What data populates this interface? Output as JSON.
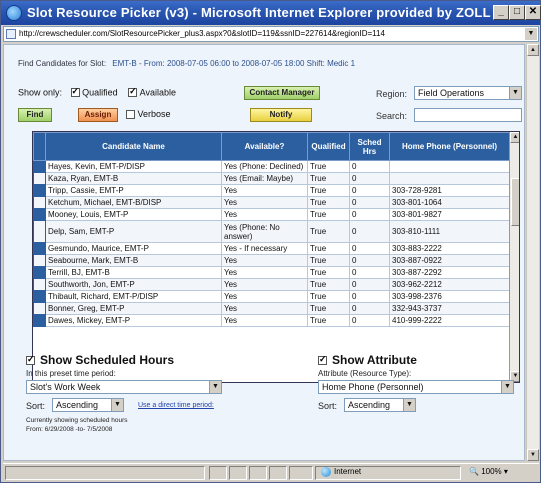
{
  "window": {
    "title": "Slot Resource Picker (v3) - Microsoft Internet Explorer provided by ZOLL",
    "min": "_",
    "max": "□",
    "close": "✕"
  },
  "address": {
    "url": "http://crewscheduler.com/SlotResourcePicker_plus3.aspx?0&slotID=119&ssnID=227614&regionID=114"
  },
  "header": {
    "find_label": "Find Candidates for Slot:",
    "slot_info": "EMT-B - From: 2008-07-05 06:00 to 2008-07-05 18:00 Shift: Medic 1"
  },
  "filters": {
    "show_only": "Show only:",
    "qualified": "Qualified",
    "available": "Available",
    "verbose": "Verbose",
    "qualified_checked": true,
    "available_checked": true,
    "verbose_checked": false
  },
  "buttons": {
    "find": "Find",
    "assign": "Assign",
    "contact_manager": "Contact Manager",
    "notify": "Notify"
  },
  "region": {
    "label": "Region:",
    "value": "Field Operations"
  },
  "search": {
    "label": "Search:",
    "value": ""
  },
  "grid": {
    "columns": [
      "Candidate Name",
      "Available?",
      "Qualified",
      "Sched Hrs",
      "Home Phone (Personnel)"
    ],
    "rows": [
      [
        "Hayes, Kevin, EMT-P/DISP",
        "Yes (Phone: Declined)",
        "True",
        "0",
        ""
      ],
      [
        "Kaza, Ryan, EMT-B",
        "Yes (Email: Maybe)",
        "True",
        "0",
        ""
      ],
      [
        "Tripp, Cassie, EMT-P",
        "Yes",
        "True",
        "0",
        "303-728-9281"
      ],
      [
        "Ketchum, Michael, EMT-B/DISP",
        "Yes",
        "True",
        "0",
        "303-801-1064"
      ],
      [
        "Mooney, Louis, EMT-P",
        "Yes",
        "True",
        "0",
        "303-801-9827"
      ],
      [
        "Delp, Sam, EMT-P",
        "Yes (Phone: No answer)",
        "True",
        "0",
        "303-810-1111"
      ],
      [
        "Gesmundo, Maurice, EMT-P",
        "Yes - If necessary",
        "True",
        "0",
        "303-883-2222"
      ],
      [
        "Seabourne, Mark, EMT-B",
        "Yes",
        "True",
        "0",
        "303-887-0922"
      ],
      [
        "Terrill, BJ, EMT-B",
        "Yes",
        "True",
        "0",
        "303-887-2292"
      ],
      [
        "Southworth, Jon, EMT-P",
        "Yes",
        "True",
        "0",
        "303-962-2212"
      ],
      [
        "Thibault, Richard, EMT-P/DISP",
        "Yes",
        "True",
        "0",
        "303-998-2376"
      ],
      [
        "Bonner, Greg, EMT-P",
        "Yes",
        "True",
        "0",
        "332-943-3737"
      ],
      [
        "Dawes, Mickey, EMT-P",
        "Yes",
        "True",
        "0",
        "410-999-2222"
      ]
    ]
  },
  "scheduled": {
    "title": "Show Scheduled Hours",
    "checked": true,
    "period_label": "In this preset time period:",
    "period_value": "Slot's Work Week",
    "sort_label": "Sort:",
    "sort_value": "Ascending",
    "link": "Use a direct time period:",
    "note1": "Currently showing scheduled hours",
    "note2": "From: 6/29/2008 -to- 7/5/2008"
  },
  "attribute": {
    "title": "Show Attribute",
    "checked": true,
    "type_label": "Attribute (Resource Type):",
    "type_value": "Home Phone (Personnel)",
    "sort_label": "Sort:",
    "sort_value": "Ascending"
  },
  "status": {
    "zone": "Internet",
    "zoom": "100%"
  },
  "icons": [
    "ie-icon",
    "page-icon",
    "dropdown-arrow-icon",
    "globe-icon",
    "scroll-up-icon",
    "scroll-down-icon"
  ]
}
